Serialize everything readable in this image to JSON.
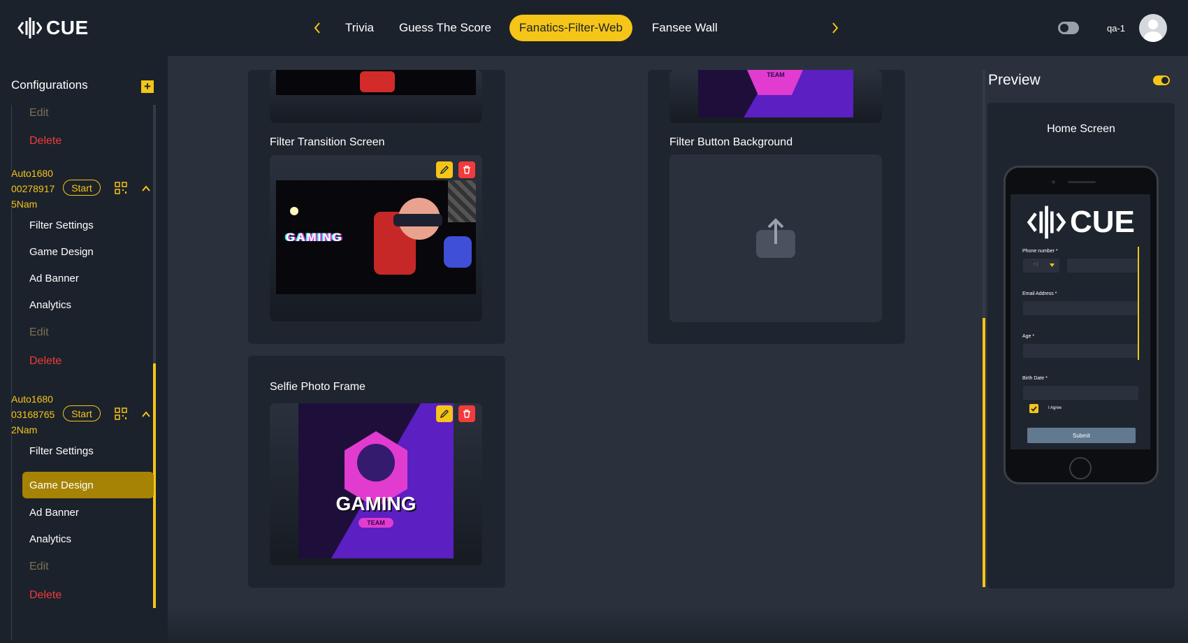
{
  "app": {
    "logo_text": "CUE",
    "user_name": "qa-1"
  },
  "tabs": [
    {
      "label": "Trivia"
    },
    {
      "label": "Guess The Score"
    },
    {
      "label": "Fanatics-Filter-Web",
      "active": true
    },
    {
      "label": "Fansee Wall"
    }
  ],
  "sidebar": {
    "title": "Configurations",
    "add_label": "+",
    "top": {
      "edit": "Edit",
      "delete": "Delete"
    },
    "games": [
      {
        "name_lines": [
          "Auto1680",
          "00278917",
          "5Nam"
        ],
        "start_label": "Start",
        "items": [
          "Filter Settings",
          "Game Design",
          "Ad Banner",
          "Analytics"
        ],
        "edit": "Edit",
        "delete": "Delete"
      },
      {
        "name_lines": [
          "Auto1680",
          "03168765",
          "2Nam"
        ],
        "start_label": "Start",
        "items": [
          "Filter Settings",
          "Game Design",
          "Ad Banner",
          "Analytics"
        ],
        "active_item": "Game Design",
        "edit": "Edit",
        "delete": "Delete"
      }
    ]
  },
  "main": {
    "filter_transition_label": "Filter Transition Screen",
    "filter_button_bg_label": "Filter Button Background",
    "selfie_frame_label": "Selfie Photo Frame",
    "gaming_text": "GAMING",
    "team_text": "TEAM"
  },
  "preview": {
    "title": "Preview",
    "screen_label": "Home Screen",
    "form": {
      "phone_label": "Phone number *",
      "country_code": "+1",
      "email_label": "Email Address *",
      "age_label": "Age *",
      "birth_label": "Birth Date *",
      "agree_label": "I Agree",
      "submit_label": "Submit"
    }
  },
  "colors": {
    "accent": "#f5c518",
    "danger": "#f23b3b",
    "bg": "#1c222c",
    "main_bg": "#2a313d"
  }
}
